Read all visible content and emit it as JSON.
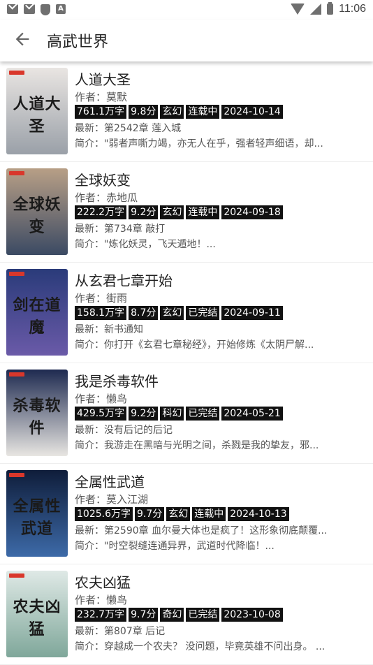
{
  "status_bar": {
    "time": "11:06"
  },
  "app_bar": {
    "title": "高武世界"
  },
  "colors": {
    "tag_bg": "#111111",
    "tag_text": "#ffffff",
    "accent_red": "#d9372b"
  },
  "books": [
    {
      "title": "人道大圣",
      "author": "作者：莫默",
      "tags": [
        "761.1万字",
        "9.8分",
        "玄幻",
        "连载中",
        "2024-10-14"
      ],
      "latest": "最新：第2542章 莲入城",
      "intro": "简介：\"弱者声嘶力竭，亦无人在乎，强者轻声细语，却...",
      "cover_text": "人道大圣",
      "cover_colors": [
        "#e9e5e2",
        "#9aa0a8"
      ]
    },
    {
      "title": "全球妖变",
      "author": "作者：赤地瓜",
      "tags": [
        "222.2万字",
        "9.2分",
        "玄幻",
        "连载中",
        "2024-09-18"
      ],
      "latest": "最新：第734章 敲打",
      "intro": "简介：\"炼化妖灵，飞天遁地！...",
      "cover_text": "全球妖变",
      "cover_colors": [
        "#b89f86",
        "#3b4a63"
      ]
    },
    {
      "title": "从玄君七章开始",
      "author": "作者：街雨",
      "tags": [
        "158.1万字",
        "8.7分",
        "玄幻",
        "已完结",
        "2024-09-11"
      ],
      "latest": "最新：新书通知",
      "intro": "简介：你打开《玄君七章秘经》，开始修炼《太阴尸解...",
      "cover_text": "剑在道魔",
      "cover_colors": [
        "#2a3b7a",
        "#6a5aa8"
      ]
    },
    {
      "title": "我是杀毒软件",
      "author": "作者：懒鸟",
      "tags": [
        "429.5万字",
        "9.2分",
        "科幻",
        "已完结",
        "2024-05-21"
      ],
      "latest": "最新：没有后记的后记",
      "intro": "简介：我游走在黑暗与光明之间，杀戮是我的挚友，邪...",
      "cover_text": "杀毒软件",
      "cover_colors": [
        "#1e2a50",
        "#e8e6e2"
      ]
    },
    {
      "title": "全属性武道",
      "author": "作者：莫入江湖",
      "tags": [
        "1025.6万字",
        "9.7分",
        "玄幻",
        "连载中",
        "2024-10-13"
      ],
      "latest": "最新：第2590章 血尔曼大体也是疯了！这形象彻底颠覆...",
      "intro": "简介：\"时空裂缝连通异界，武道时代降临！...",
      "cover_text": "全属性武道",
      "cover_colors": [
        "#0f1d3a",
        "#3d6aa8"
      ]
    },
    {
      "title": "农夫凶猛",
      "author": "作者：懒鸟",
      "tags": [
        "232.7万字",
        "9.7分",
        "奇幻",
        "已完结",
        "2023-10-08"
      ],
      "latest": "最新：第807章 后记",
      "intro": "简介：穿越成一个农夫？ 没问题，毕竟英雄不问出身。 ...",
      "cover_text": "农夫凶猛",
      "cover_colors": [
        "#dfe9e6",
        "#7fa79a"
      ]
    }
  ]
}
